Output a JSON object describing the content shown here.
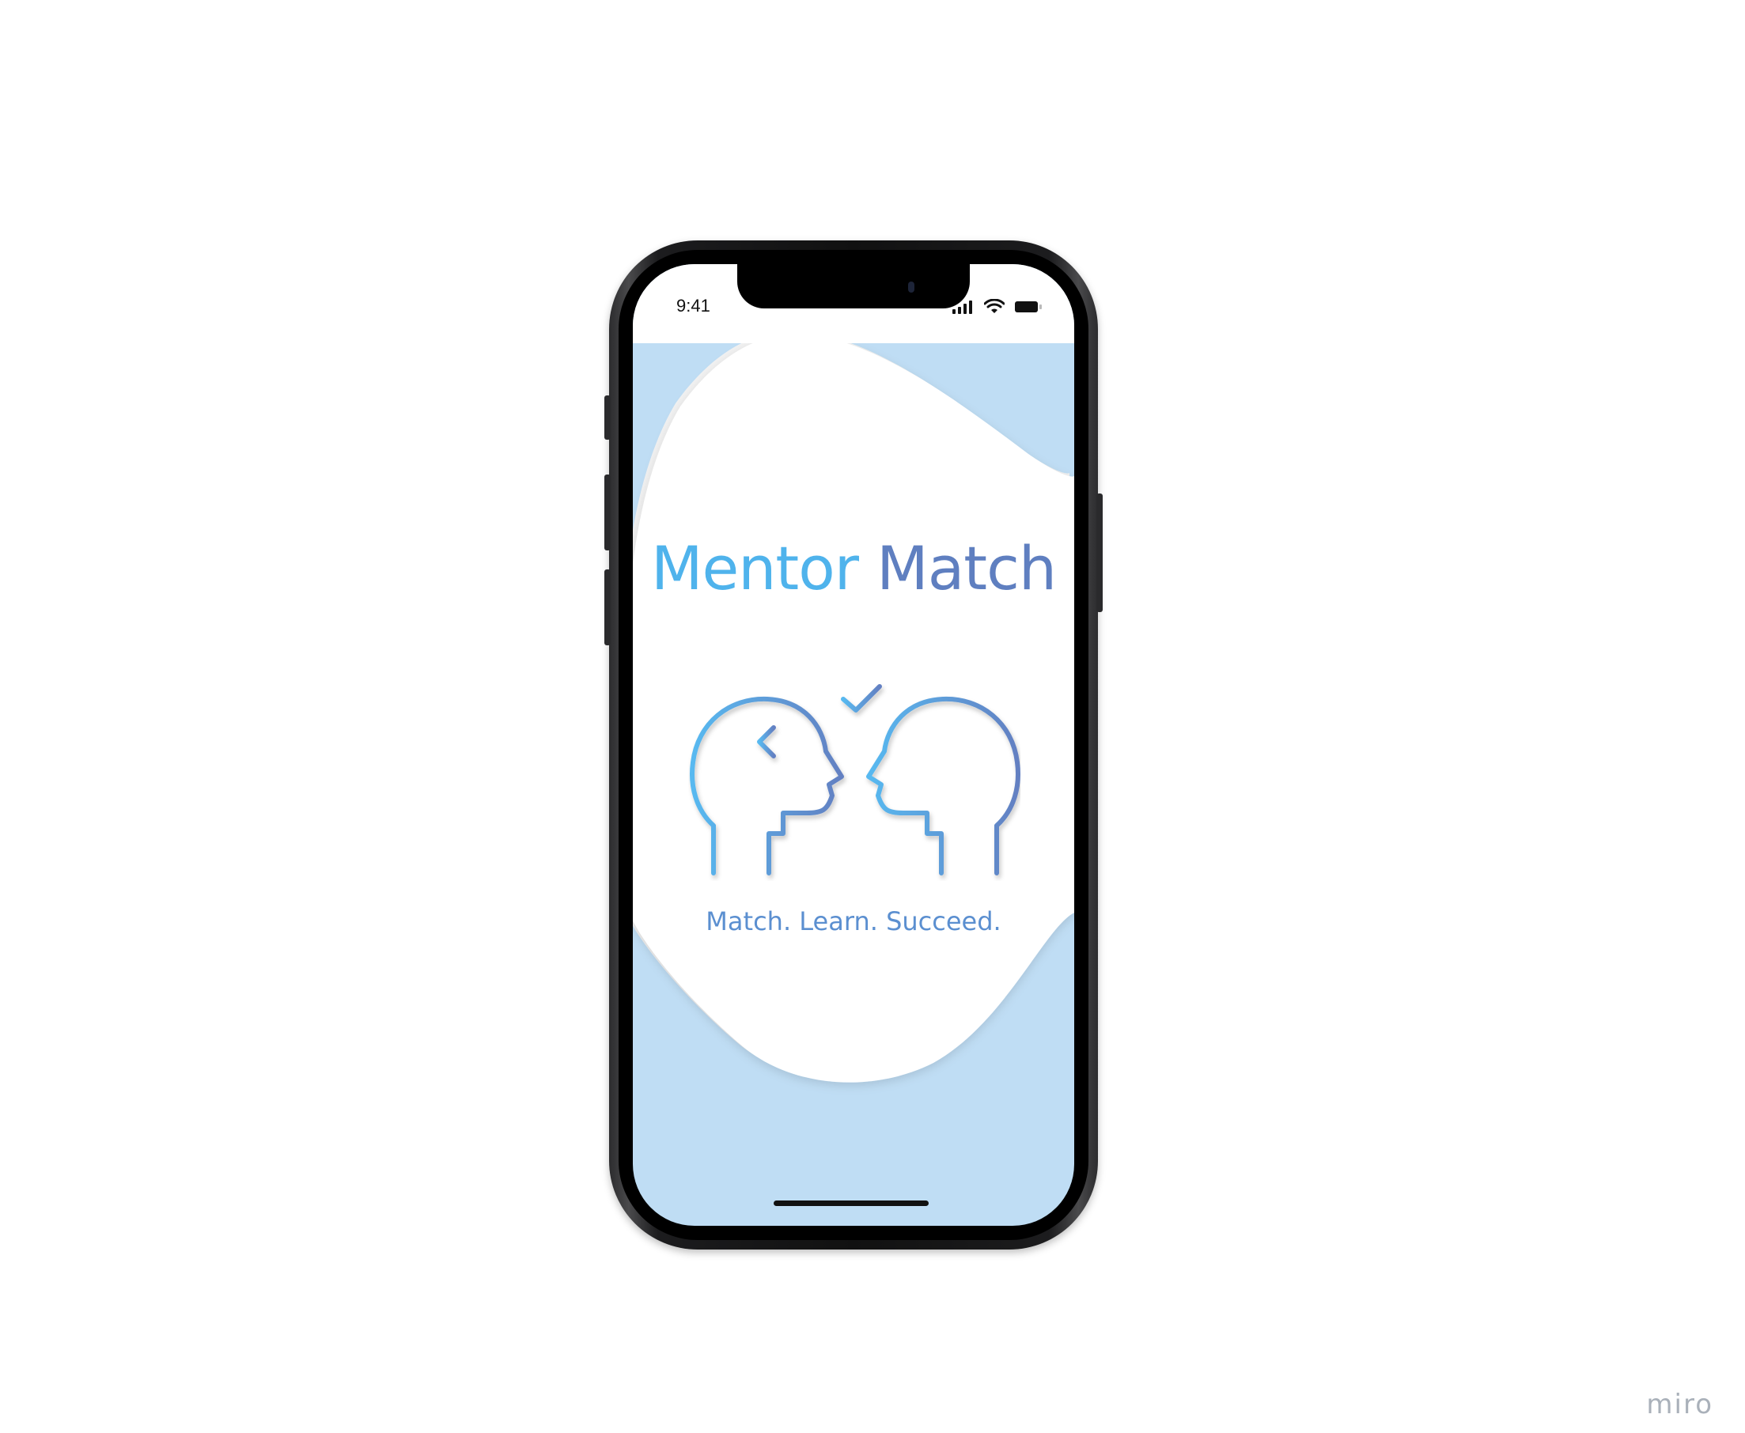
{
  "status_bar": {
    "time": "9:41",
    "icons": [
      "cellular-signal-icon",
      "wifi-icon",
      "battery-icon"
    ]
  },
  "splash": {
    "title_word_1": "Mentor",
    "title_word_2": "Match",
    "tagline": "Match. Learn. Succeed.",
    "logo_icon": "two-heads-mentor-match-icon"
  },
  "colors": {
    "background_blue": "#bfddf4",
    "title_light_blue": "#4fb3ec",
    "title_dark_blue": "#5f7fc0",
    "tagline_blue": "#5b8fd0"
  },
  "watermark": "miro"
}
